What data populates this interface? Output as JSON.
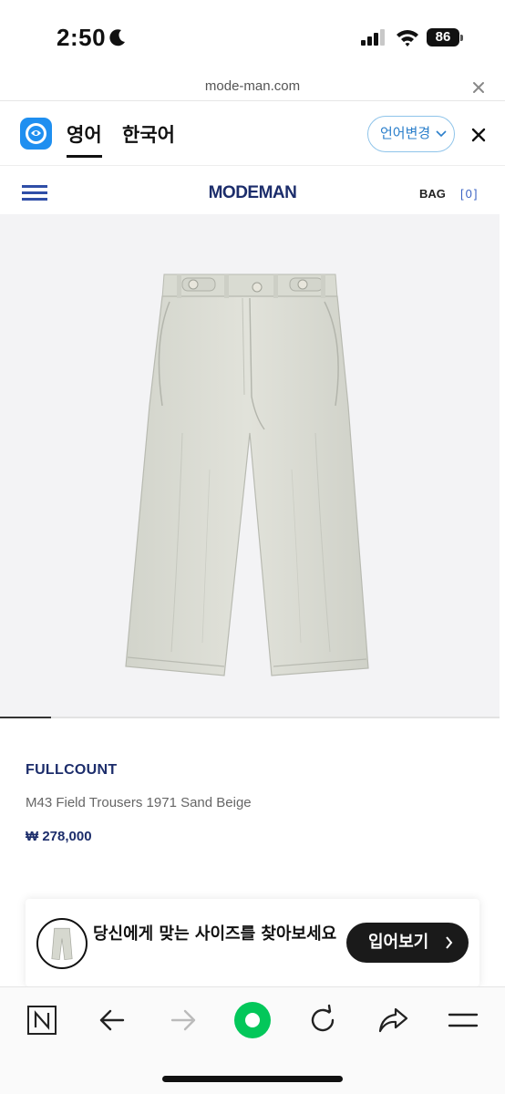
{
  "status_bar": {
    "time": "2:50",
    "battery": "86",
    "icons": [
      "moon-icon",
      "signal-icon",
      "wifi-icon",
      "battery-icon"
    ]
  },
  "browser": {
    "url": "mode-man.com"
  },
  "translate_bar": {
    "languages": [
      "영어",
      "한국어"
    ],
    "selected": "영어",
    "change_language_label": "언어변경",
    "accent_color": "#1f8ff0"
  },
  "site": {
    "logo": "MODEMAN",
    "bag_label": "BAG",
    "bag_count": "[0]",
    "brand_color": "#1c2d6b"
  },
  "gallery": {
    "current_slide": 1,
    "image": "sand-beige-field-trousers"
  },
  "product": {
    "brand": "FULLCOUNT",
    "name": "M43 Field Trousers 1971 Sand Beige",
    "price": "₩ 278,000"
  },
  "size_banner": {
    "text": "당신에게 맞는 사이즈를 찾아보세요",
    "button_label": "입어보기"
  },
  "toolbar": {
    "items": [
      "naver-home-icon",
      "back-arrow-icon",
      "forward-arrow-icon",
      "green-circle-icon",
      "refresh-icon",
      "share-icon",
      "menu-icon"
    ],
    "active_color": "#03c75a"
  }
}
